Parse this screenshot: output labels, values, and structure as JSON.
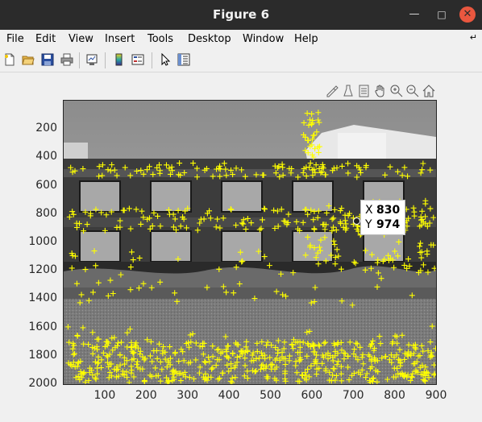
{
  "window": {
    "title": "Figure 6"
  },
  "menu": [
    "File",
    "Edit",
    "View",
    "Insert",
    "Tools",
    "Desktop",
    "Window",
    "Help"
  ],
  "toolbar_icons": [
    "new-figure-icon",
    "open-file-icon",
    "save-icon",
    "print-icon",
    "link-plot-icon",
    "insert-colorbar-icon",
    "insert-legend-icon",
    "edit-plot-arrow-icon",
    "property-inspector-icon"
  ],
  "axes_toolbar_icons": [
    "brush-icon",
    "data-tips-icon",
    "rotate-icon",
    "pan-hand-icon",
    "zoom-in-icon",
    "zoom-out-icon",
    "home-icon"
  ],
  "colors": {
    "marker": "#ffff00",
    "titlebar": "#2b2b2b",
    "close": "#e9573f"
  },
  "chart_data": {
    "type": "scatter",
    "marker": "+",
    "background": "grayscale photograph of building facade and street",
    "xlim": [
      1,
      900
    ],
    "ylim": [
      0,
      2000
    ],
    "y_reversed": true,
    "xticks": [
      "100",
      "200",
      "300",
      "400",
      "500",
      "600",
      "700",
      "800",
      "900"
    ],
    "yticks": [
      "200",
      "400",
      "600",
      "800",
      "1000",
      "1200",
      "1400",
      "1600",
      "1800",
      "2000"
    ],
    "clusters": [
      {
        "x": [
          10,
          890
        ],
        "y": [
          440,
          540
        ],
        "n": 110
      },
      {
        "x": [
          10,
          900
        ],
        "y": [
          760,
          920
        ],
        "n": 140
      },
      {
        "x": [
          560,
          900
        ],
        "y": [
          700,
          1200
        ],
        "n": 90
      },
      {
        "x": [
          580,
          620
        ],
        "y": [
          80,
          420
        ],
        "n": 30
      },
      {
        "x": [
          10,
          900
        ],
        "y": [
          1050,
          1460
        ],
        "n": 70
      },
      {
        "x": [
          10,
          900
        ],
        "y": [
          1700,
          1990
        ],
        "n": 520
      },
      {
        "x": [
          10,
          900
        ],
        "y": [
          1580,
          1700
        ],
        "n": 25
      }
    ],
    "datatip": {
      "x": "830",
      "y": "974"
    }
  }
}
